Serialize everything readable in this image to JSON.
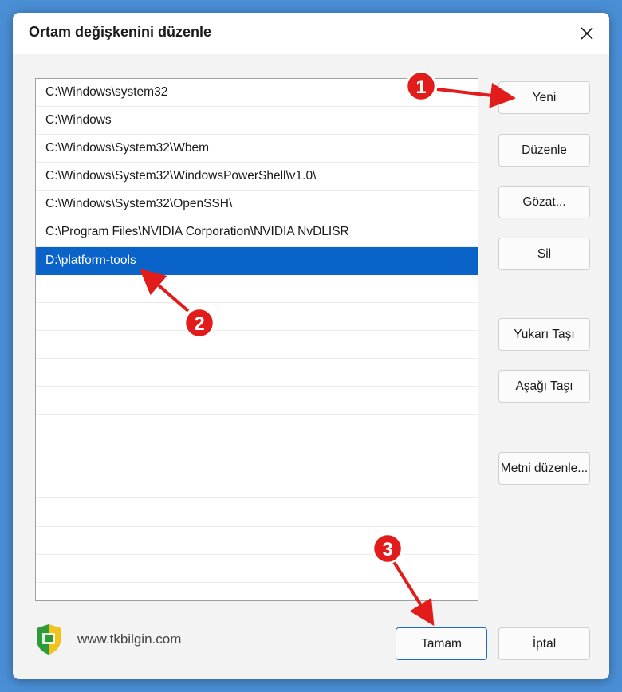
{
  "window": {
    "title": "Ortam değişkenini düzenle"
  },
  "list": {
    "items": [
      "C:\\Windows\\system32",
      "C:\\Windows",
      "C:\\Windows\\System32\\Wbem",
      "C:\\Windows\\System32\\WindowsPowerShell\\v1.0\\",
      "C:\\Windows\\System32\\OpenSSH\\",
      "C:\\Program Files\\NVIDIA Corporation\\NVIDIA NvDLISR",
      "D:\\platform-tools",
      "",
      "",
      "",
      "",
      "",
      "",
      "",
      "",
      "",
      "",
      "",
      ""
    ],
    "selected_index": 6
  },
  "buttons": {
    "new": "Yeni",
    "edit": "Düzenle",
    "browse": "Gözat...",
    "delete": "Sil",
    "move_up": "Yukarı Taşı",
    "move_down": "Aşağı Taşı",
    "edit_text": "Metni düzenle...",
    "ok": "Tamam",
    "cancel": "İptal"
  },
  "footer": {
    "site": "www.tkbilgin.com"
  },
  "annotations": [
    "1",
    "2",
    "3"
  ],
  "colors": {
    "selection": "#0a63c9",
    "annotation_red": "#e21b1b",
    "desktop_blue": "#4a8fd6",
    "logo_green": "#2e9a3a",
    "logo_yellow": "#f2c31a"
  },
  "icons": {
    "close": "close-icon",
    "logo": "shield-logo-icon"
  }
}
